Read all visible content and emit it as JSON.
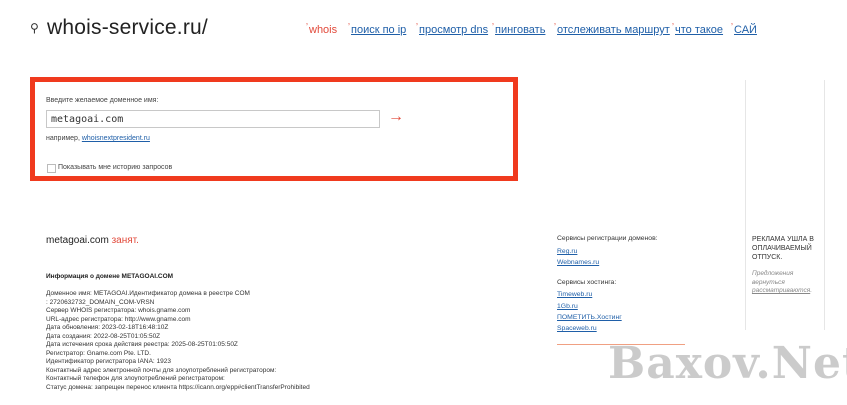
{
  "header": {
    "logo_text": "whois-service.ru/",
    "nav": [
      {
        "label": "whois",
        "active": true
      },
      {
        "label": "поиск по ip"
      },
      {
        "label": "просмотр dns"
      },
      {
        "label": "пинговать"
      },
      {
        "label": "отслеживать маршрут"
      },
      {
        "label": "что такое"
      },
      {
        "label": "САЙ"
      }
    ]
  },
  "search": {
    "label": "Введите желаемое доменное имя:",
    "value": "metagoai.com",
    "arrow": "→",
    "example_prefix": "например, ",
    "example_link": "whoisnextpresident.ru",
    "history_label": "Показывать мне историю запросов"
  },
  "result": {
    "domain": "metagoai.com",
    "status": "занят."
  },
  "info": {
    "heading": "Информация о домене METAGOAI.COM",
    "lines": [
      "Доменное имя: METAGOAI.Идентификатор домена в реестре COM",
      ": 2720632732_DOMAIN_COM-VRSN",
      "Сервер WHOIS регистратора: whois.gname.com",
      "URL-адрес регистратора: http://www.gname.com",
      "Дата обновления: 2023-02-18T16:48:10Z",
      "Дата создания: 2022-08-25T01:05:50Z",
      "Дата истечения срока действия реестра: 2025-08-25T01:05:50Z",
      "Регистратор: Gname.com Pte. LTD.",
      "Идентификатор регистратора IANA: 1923",
      "Контактный адрес электронной почты для злоупотреблений регистратором:",
      "Контактный телефон для злоупотреблений регистратором:",
      "Статус домена: запрещен перенос клиента https://icann.org/epp#clientTransferProhibited"
    ]
  },
  "services": {
    "registration_heading": "Сервисы регистрации доменов:",
    "registration_links": [
      "Reg.ru",
      "Webnames.ru"
    ],
    "hosting_heading": "Сервисы хостинга:",
    "hosting_links": [
      "Timeweb.ru",
      "1Gb.ru",
      "ПОМЕТИТЬ.Хостинг",
      "Spaceweb.ru"
    ]
  },
  "ad": {
    "title": "РЕКЛАМА УШЛА В ОПЛАЧИВАЕМЫЙ ОТПУСК.",
    "note_prefix": "Предложения вернуться ",
    "note_link": "рассматриваются",
    "note_suffix": "."
  },
  "watermark": "Baxov.Net",
  "colors": {
    "accent_red": "#e24a3b",
    "box_border": "#f03a1e",
    "link_blue": "#1f5fa8"
  }
}
